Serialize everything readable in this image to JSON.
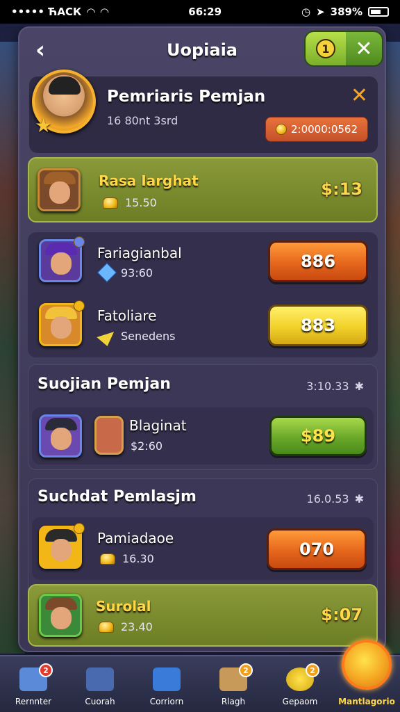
{
  "status_bar": {
    "carrier": "••••• ЋАСК",
    "time": "66:29",
    "battery": "389%"
  },
  "header": {
    "title": "Uopiaia",
    "info_label": "1"
  },
  "player": {
    "name": "Pemriaris Pemjan",
    "subtitle": "16 80nt 3srd",
    "timer": "2:0000:0562"
  },
  "rows": [
    {
      "name": "Rasa Iarghat",
      "amount": "15.50",
      "price": "$:13",
      "style": "green"
    },
    {
      "name": "Fariagianbal",
      "amount": "93:60",
      "button": "886",
      "button_style": "orange"
    },
    {
      "name": "Fatoliare",
      "amount": "Senedens",
      "button": "883",
      "button_style": "yellow"
    }
  ],
  "sections": [
    {
      "title": "Suojian Pemjan",
      "time": "3:10.33",
      "items": [
        {
          "name": "Blaginat",
          "amount": "$2:60",
          "button": "$89",
          "button_style": "green"
        }
      ]
    },
    {
      "title": "Suchdat Pemlasjm",
      "time": "16.0.53",
      "items": [
        {
          "name": "Pamiadaoe",
          "amount": "16.30",
          "button": "070",
          "button_style": "orange"
        },
        {
          "name": "Surolal",
          "amount": "23.40",
          "price": "$:07",
          "style": "green"
        }
      ]
    }
  ],
  "nav": [
    {
      "label": "Rernnter",
      "icon": "home-icon",
      "badge": "2"
    },
    {
      "label": "Cuorah",
      "icon": "cards-icon"
    },
    {
      "label": "Corriorn",
      "icon": "chart-icon"
    },
    {
      "label": "Rlagh",
      "icon": "chest-icon",
      "badge": "2"
    },
    {
      "label": "Gepaom",
      "icon": "coin-icon",
      "badge": "2"
    },
    {
      "label": "Mantlagorio",
      "icon": "shield-icon",
      "active": true
    }
  ]
}
